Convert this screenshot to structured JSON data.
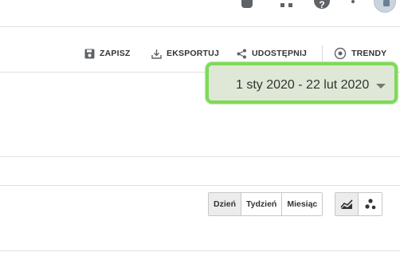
{
  "toolbar": {
    "save_label": "ZAPISZ",
    "export_label": "EKSPORTUJ",
    "share_label": "UDOSTĘPNIJ",
    "trends_label": "TRENDY"
  },
  "date_range": {
    "label": "1 sty 2020 - 22 lut 2020"
  },
  "granularity": {
    "options": [
      "Dzień",
      "Tydzień",
      "Miesiąc"
    ],
    "selected": "Dzień"
  },
  "chart_type": {
    "options": [
      "line-chart-icon",
      "motion-chart-icon"
    ],
    "selected": "line-chart-icon"
  },
  "header_icons": [
    "notifications-icon",
    "apps-icon",
    "help-icon",
    "more-vert-icon",
    "account-avatar"
  ],
  "colors": {
    "highlight_border": "#7ed957",
    "highlight_fill": "#dfe8d6"
  }
}
